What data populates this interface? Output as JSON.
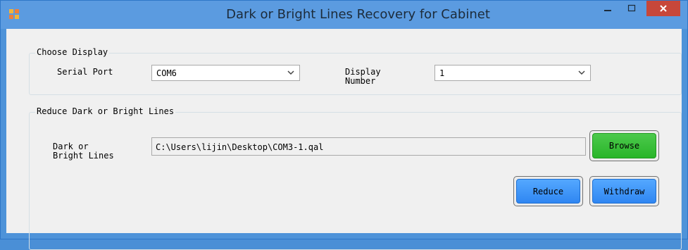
{
  "window": {
    "title": "Dark or Bright Lines Recovery for Cabinet",
    "controls": {
      "minimize": "–",
      "maximize": "□",
      "close": "✕"
    }
  },
  "choose_display": {
    "legend": "Choose Display",
    "serial_port_label": "Serial Port",
    "serial_port_value": "COM6",
    "display_number_label": "Display\nNumber",
    "display_number_value": "1"
  },
  "reduce_lines": {
    "legend": "Reduce Dark or Bright Lines",
    "file_label": "Dark or\nBright Lines",
    "file_path": "C:\\Users\\lijin\\Desktop\\COM3-1.qal",
    "browse_label": "Browse",
    "reduce_label": "Reduce",
    "withdraw_label": "Withdraw"
  },
  "colors": {
    "titlebar": "#5b9be0",
    "close_button": "#c7473a",
    "browse_button": "#2fb82f",
    "action_button": "#3a90f7"
  }
}
